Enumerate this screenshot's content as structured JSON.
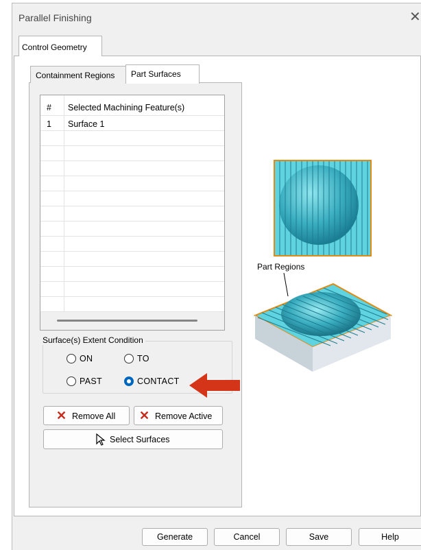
{
  "window": {
    "title": "Parallel Finishing",
    "close_glyph": "✕"
  },
  "outer_tab": {
    "label": "Control Geometry"
  },
  "inner_tabs": [
    {
      "label": "Containment Regions"
    },
    {
      "label": "Part Surfaces"
    }
  ],
  "table": {
    "headers": [
      "#",
      "Selected Machining Feature(s)"
    ],
    "rows": [
      {
        "num": "1",
        "name": "Surface 1"
      }
    ]
  },
  "extent": {
    "label": "Surface(s) Extent Condition",
    "options": [
      "ON",
      "TO",
      "PAST",
      "CONTACT"
    ],
    "selected": "CONTACT"
  },
  "buttons": {
    "remove_all": "Remove All",
    "remove_active": "Remove Active",
    "select_surfaces": "Select Surfaces"
  },
  "illustration": {
    "label": "Part Regions"
  },
  "footer": {
    "generate": "Generate",
    "cancel": "Cancel",
    "save": "Save",
    "help": "Help"
  },
  "colors": {
    "accent": "#0067c0",
    "callout_arrow": "#d43417",
    "surface_cyan": "#3fc9d8",
    "edge_orange": "#e08a13"
  }
}
